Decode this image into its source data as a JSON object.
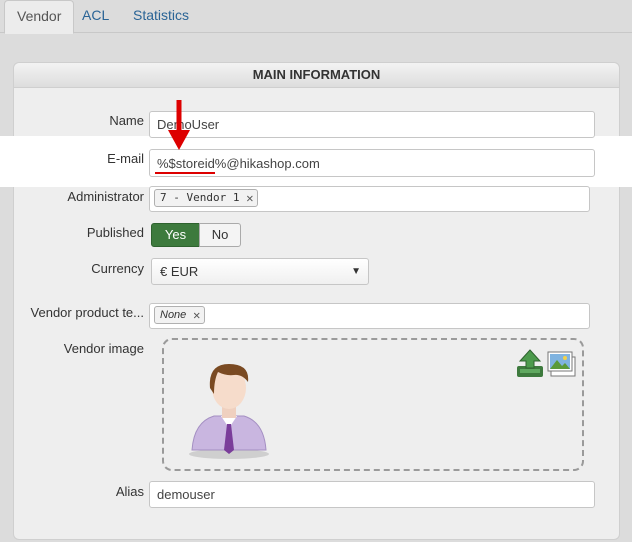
{
  "tabs": [
    {
      "label": "Vendor",
      "active": true
    },
    {
      "label": "ACL",
      "active": false
    },
    {
      "label": "Statistics",
      "active": false
    }
  ],
  "panel": {
    "title": "MAIN INFORMATION"
  },
  "fields": {
    "name": {
      "label": "Name",
      "value": "DemoUser"
    },
    "email": {
      "label": "E-mail",
      "value": "%$storeid%@hikashop.com"
    },
    "administrator": {
      "label": "Administrator",
      "token": "7 - Vendor 1"
    },
    "published": {
      "label": "Published",
      "yes": "Yes",
      "no": "No",
      "selected": "Yes"
    },
    "currency": {
      "label": "Currency",
      "value": "€ EUR"
    },
    "vendor_product_template": {
      "label": "Vendor product te...",
      "token": "None"
    },
    "vendor_image": {
      "label": "Vendor image"
    },
    "alias": {
      "label": "Alias",
      "value": "demouser"
    }
  },
  "colors": {
    "accent_green": "#3d7a3d",
    "link_blue": "#2a6496",
    "annotation_red": "#dd0000"
  }
}
